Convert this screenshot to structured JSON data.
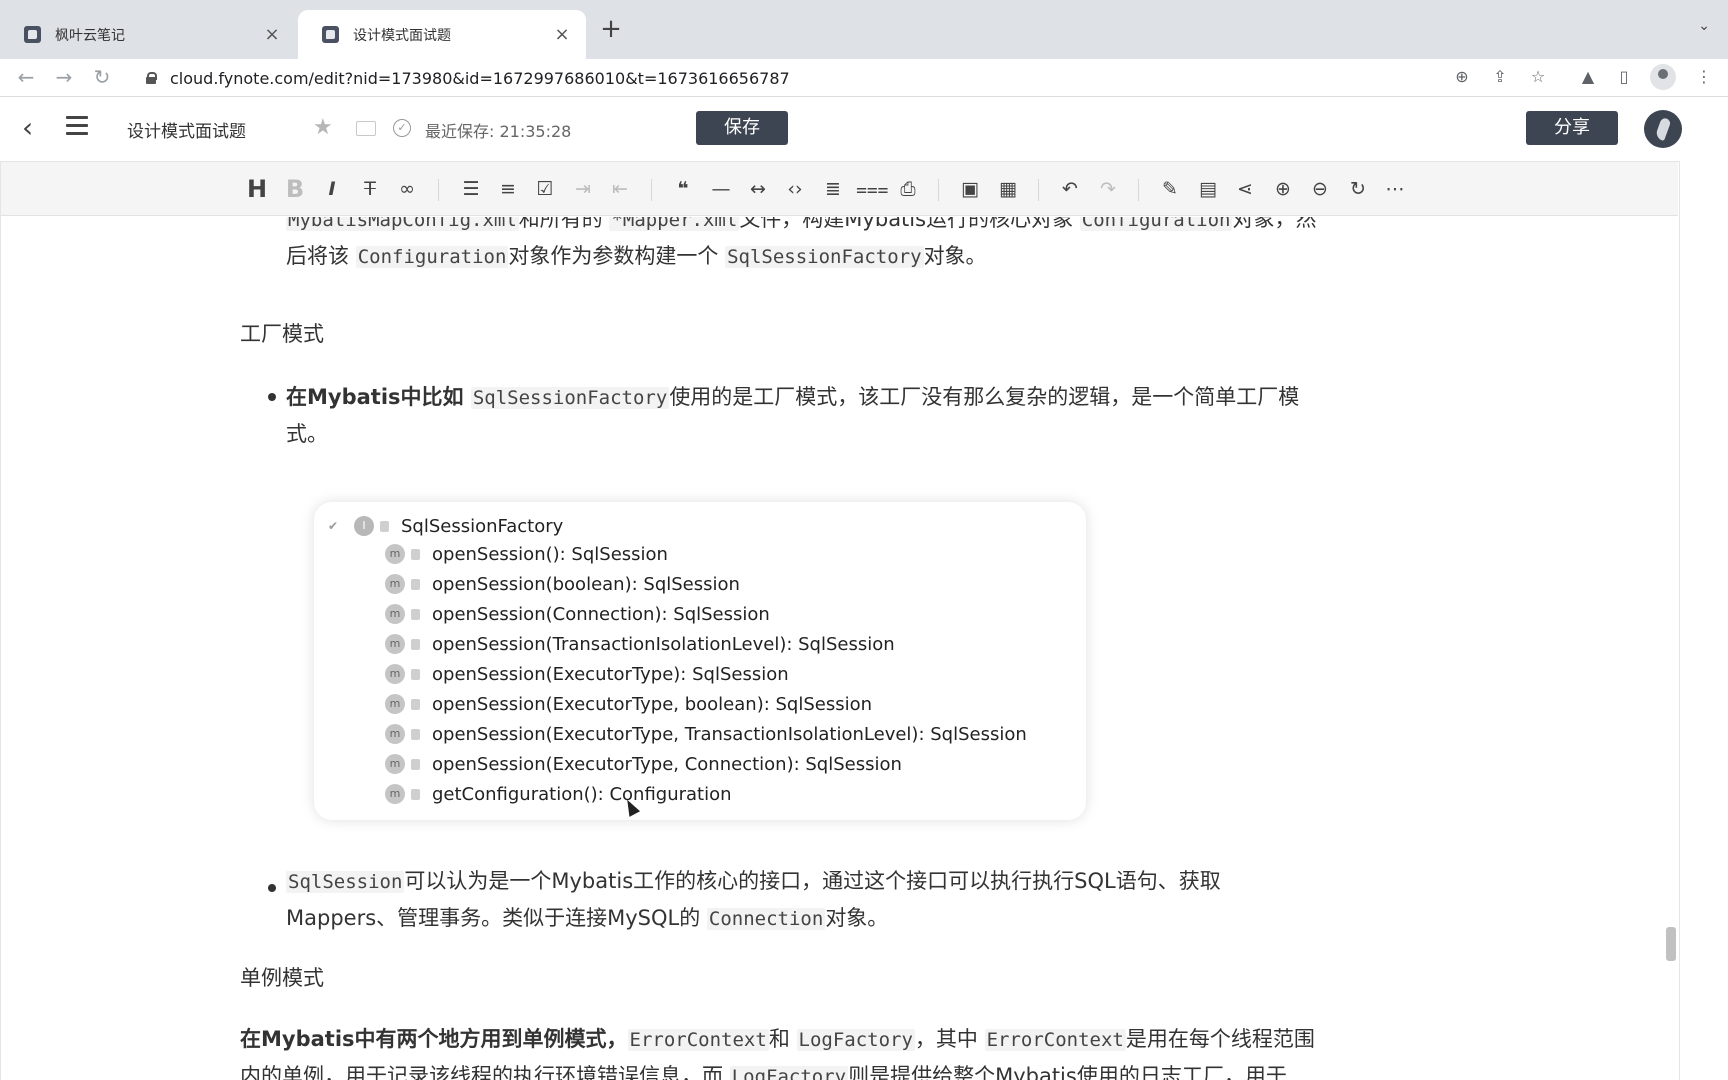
{
  "browser": {
    "tabs": [
      {
        "title": "枫叶云笔记"
      },
      {
        "title": "设计模式面试题"
      }
    ],
    "url": "cloud.fynote.com/edit?nid=173980&id=1672997686010&t=1673616656787"
  },
  "app": {
    "doc_title": "设计模式面试题",
    "save_status": "最近保存: 21:35:28",
    "save_label": "保存",
    "share_label": "分享"
  },
  "content": {
    "para1": {
      "t1": "MybatisMapConfig.xml",
      "t2": "和所有的 ",
      "t3": "*Mapper.xml",
      "t4": "文件，构建Mybatis运行的核心对象 ",
      "t5": "Configuration",
      "t6": "对象，然",
      "t7": "后将该 ",
      "t8": "Configuration",
      "t9": "对象作为参数构建一个 ",
      "t10": "SqlSessionFactory",
      "t11": "对象。"
    },
    "heading_factory": "工厂模式",
    "bullet1": {
      "bold": "在Mybatis中比如 ",
      "code": "SqlSessionFactory",
      "rest": "使用的是工厂模式，该工厂没有那么复杂的逻辑，是一个简单工厂模",
      "rest2": "式。"
    },
    "tree": {
      "root": "SqlSessionFactory",
      "root_icon": "I",
      "method_icon": "m",
      "methods": [
        "openSession(): SqlSession",
        "openSession(boolean): SqlSession",
        "openSession(Connection): SqlSession",
        "openSession(TransactionIsolationLevel): SqlSession",
        "openSession(ExecutorType): SqlSession",
        "openSession(ExecutorType, boolean): SqlSession",
        "openSession(ExecutorType, TransactionIsolationLevel): SqlSession",
        "openSession(ExecutorType, Connection): SqlSession",
        "getConfiguration(): Configuration"
      ]
    },
    "bullet2": {
      "code": "SqlSession",
      "rest": "可以认为是一个Mybatis工作的核心的接口，通过这个接口可以执行执行SQL语句、获取",
      "line2a": "Mappers、管理事务。类似于连接MySQL的 ",
      "code2": "Connection",
      "line2b": "对象。"
    },
    "heading_singleton": "单例模式",
    "para_last": {
      "bold": "在Mybatis中有两个地方用到单例模式，",
      "c1": "ErrorContext",
      "t1": "和 ",
      "c2": "LogFactory",
      "t2": "，其中 ",
      "c3": "ErrorContext",
      "t3": "是用在每个线程范围",
      "line2a": "内的单例，用于记录该线程的执行环境错误信息，而 ",
      "c4": "LogFactory",
      "line2b": "则是提供给整个Mybatis使用的日志工厂，用于"
    }
  }
}
